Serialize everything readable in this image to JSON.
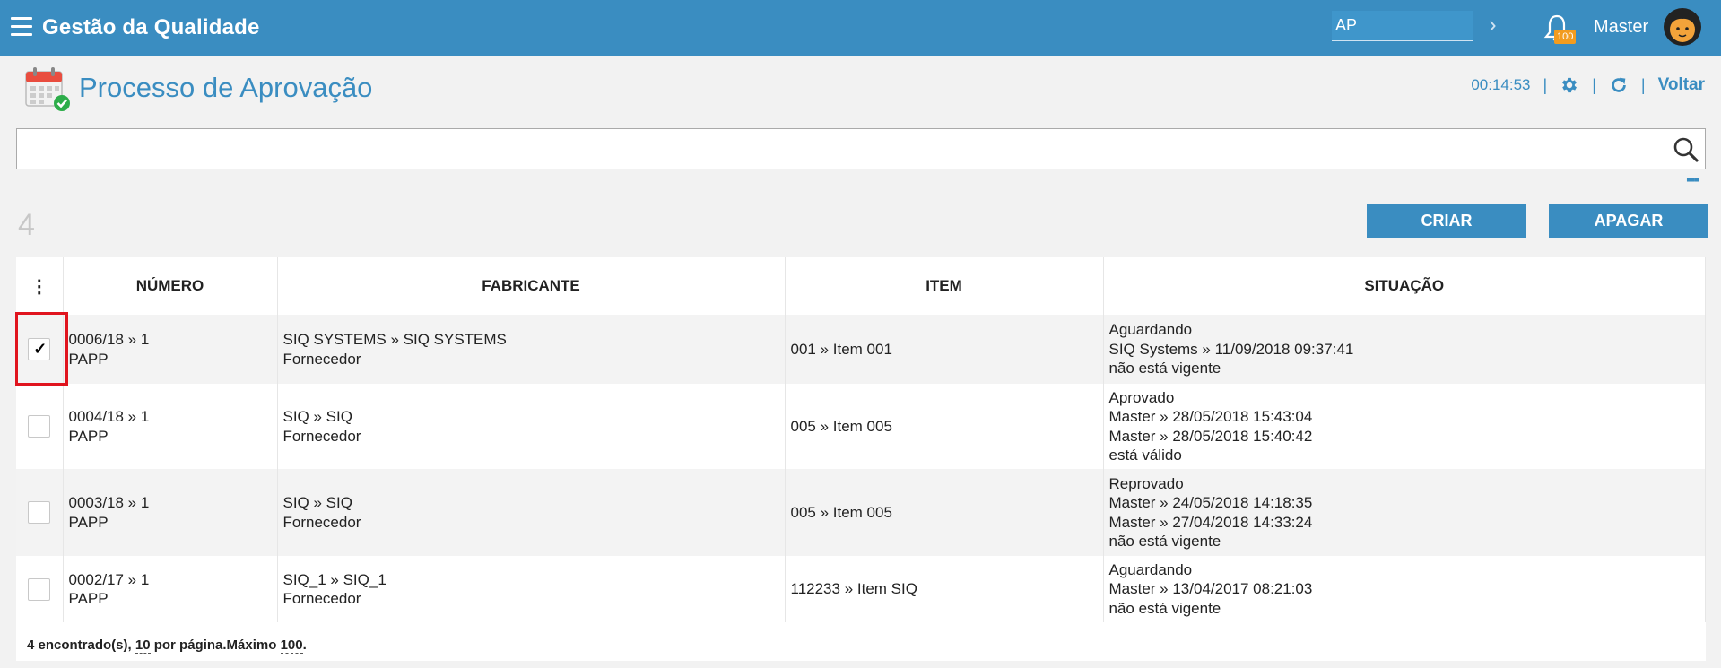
{
  "app": {
    "title": "Gestão da Qualidade",
    "module_value": "AP",
    "notification_count": "100",
    "user": "Master"
  },
  "page": {
    "title": "Processo de Aprovação",
    "timer": "00:14:53",
    "back_label": "Voltar"
  },
  "search": {
    "value": "",
    "placeholder": ""
  },
  "actions": {
    "count": "4",
    "create": "CRIAR",
    "delete": "APAGAR"
  },
  "table": {
    "columns": [
      "NÚMERO",
      "FABRICANTE",
      "ITEM",
      "SITUAÇÃO"
    ],
    "rows": [
      {
        "checked": true,
        "numero": "0006/18 » 1",
        "tipo": "PAPP",
        "fabricante": "SIQ SYSTEMS » SIQ SYSTEMS",
        "fab_tipo": "Fornecedor",
        "item": "001 » Item 001",
        "situacao": [
          "Aguardando",
          "SIQ Systems » 11/09/2018 09:37:41",
          "não está vigente"
        ]
      },
      {
        "checked": false,
        "numero": "0004/18 » 1",
        "tipo": "PAPP",
        "fabricante": "SIQ » SIQ",
        "fab_tipo": "Fornecedor",
        "item": "005 » Item 005",
        "situacao": [
          "Aprovado",
          "Master » 28/05/2018 15:43:04",
          "Master » 28/05/2018 15:40:42",
          "está válido"
        ]
      },
      {
        "checked": false,
        "numero": "0003/18 » 1",
        "tipo": "PAPP",
        "fabricante": "SIQ » SIQ",
        "fab_tipo": "Fornecedor",
        "item": "005 » Item 005",
        "situacao": [
          "Reprovado",
          "Master » 24/05/2018 14:18:35",
          "Master » 27/04/2018 14:33:24",
          "não está vigente"
        ]
      },
      {
        "checked": false,
        "numero": "0002/17 » 1",
        "tipo": "PAPP",
        "fabricante": "SIQ_1 » SIQ_1",
        "fab_tipo": "Fornecedor",
        "item": "112233 » Item SIQ",
        "situacao": [
          "Aguardando",
          "Master » 13/04/2017 08:21:03",
          "não está vigente"
        ]
      }
    ]
  },
  "footer": {
    "found": "4 encontrado(s),",
    "per_page": "10",
    "per_page_label": "por página.Máximo",
    "max": "100",
    "end": "."
  }
}
